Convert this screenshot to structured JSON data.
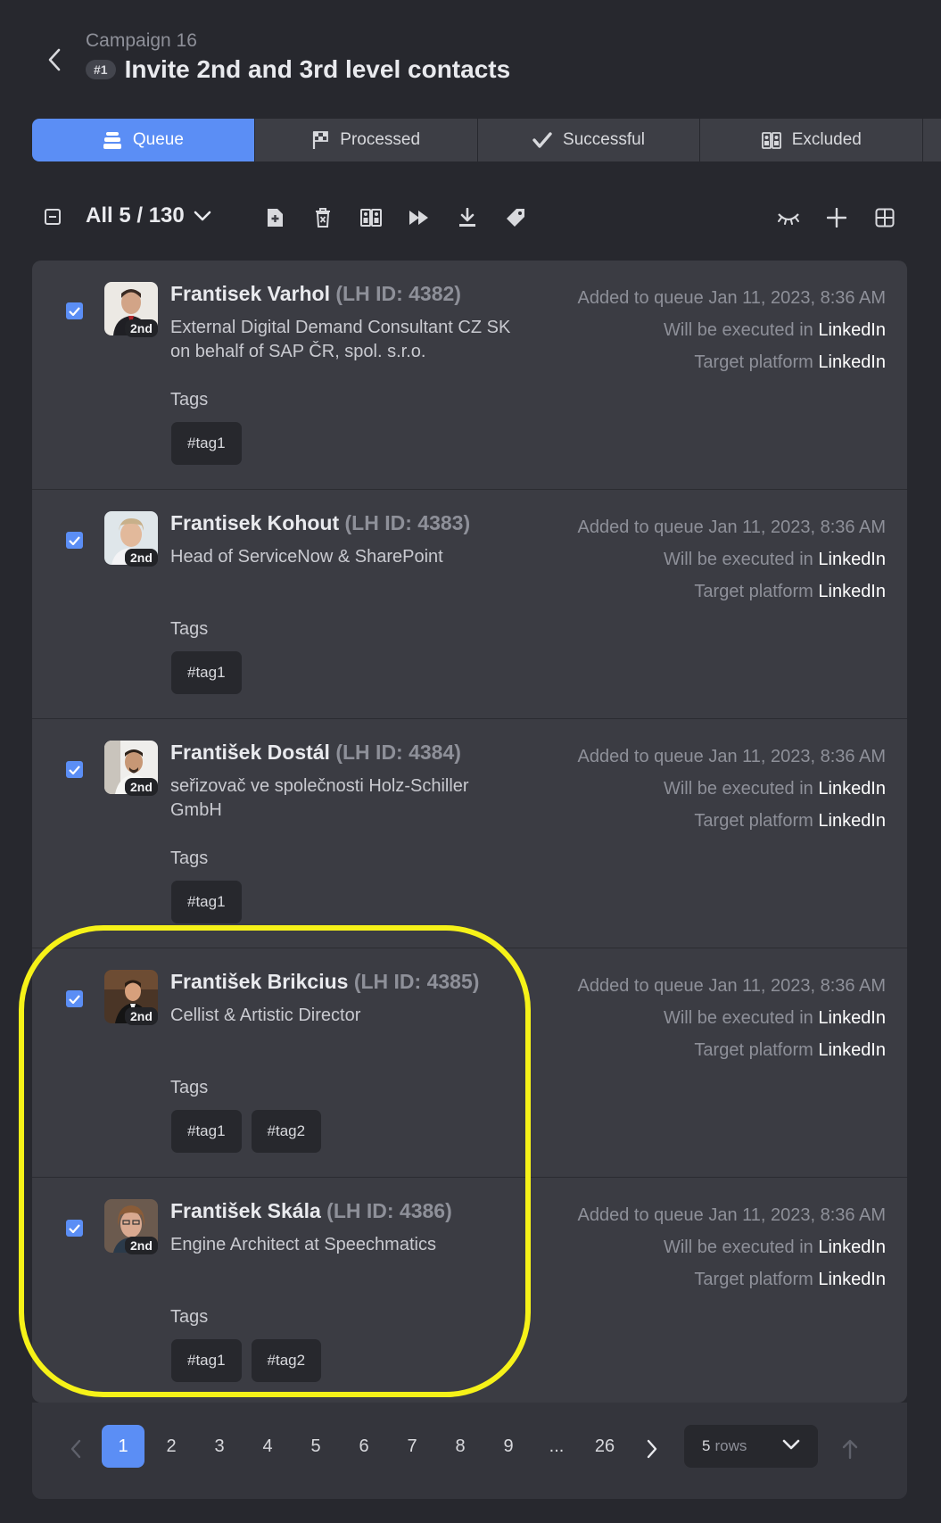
{
  "header": {
    "campaign": "Campaign 16",
    "badge": "#1",
    "title": "Invite 2nd and 3rd level contacts"
  },
  "tabs": [
    {
      "label": "Queue",
      "icon": "queue-stack-icon",
      "active": true
    },
    {
      "label": "Processed",
      "icon": "checkered-flag-icon",
      "active": false
    },
    {
      "label": "Successful",
      "icon": "checkmark-icon",
      "active": false
    },
    {
      "label": "Excluded",
      "icon": "excluded-people-icon",
      "active": false
    }
  ],
  "toolbar": {
    "selection": "All 5 / 130",
    "icons": [
      "add-to-list-icon",
      "delete-icon",
      "exclude-icon",
      "skip-forward-icon",
      "download-icon",
      "tag-icon",
      "hide-icon",
      "plus-icon",
      "grid-layout-icon"
    ]
  },
  "rows": [
    {
      "name": "Frantisek Varhol",
      "lhid": "(LH ID: 4382)",
      "degree": "2nd",
      "headline": "External Digital Demand Consultant CZ SK on behalf of SAP ČR, spol. s.r.o.",
      "tags_label": "Tags",
      "tags": [
        "#tag1"
      ],
      "added_label": "Added to queue",
      "added_date": "Jan 11, 2023, 8:36 AM",
      "exec_label": "Will be executed in",
      "exec_value": "LinkedIn",
      "platform_label": "Target platform",
      "platform_value": "LinkedIn",
      "checked": true
    },
    {
      "name": "Frantisek Kohout",
      "lhid": "(LH ID: 4383)",
      "degree": "2nd",
      "headline": "Head of ServiceNow & SharePoint",
      "tags_label": "Tags",
      "tags": [
        "#tag1"
      ],
      "added_label": "Added to queue",
      "added_date": "Jan 11, 2023, 8:36 AM",
      "exec_label": "Will be executed in",
      "exec_value": "LinkedIn",
      "platform_label": "Target platform",
      "platform_value": "LinkedIn",
      "checked": true
    },
    {
      "name": "František Dostál",
      "lhid": "(LH ID: 4384)",
      "degree": "2nd",
      "headline": "seřizovač ve společnosti Holz-Schiller GmbH",
      "tags_label": "Tags",
      "tags": [
        "#tag1"
      ],
      "added_label": "Added to queue",
      "added_date": "Jan 11, 2023, 8:36 AM",
      "exec_label": "Will be executed in",
      "exec_value": "LinkedIn",
      "platform_label": "Target platform",
      "platform_value": "LinkedIn",
      "checked": true
    },
    {
      "name": "František Brikcius",
      "lhid": "(LH ID: 4385)",
      "degree": "2nd",
      "headline": "Cellist & Artistic Director",
      "tags_label": "Tags",
      "tags": [
        "#tag1",
        "#tag2"
      ],
      "added_label": "Added to queue",
      "added_date": "Jan 11, 2023, 8:36 AM",
      "exec_label": "Will be executed in",
      "exec_value": "LinkedIn",
      "platform_label": "Target platform",
      "platform_value": "LinkedIn",
      "checked": true
    },
    {
      "name": "František Skála",
      "lhid": "(LH ID: 4386)",
      "degree": "2nd",
      "headline": "Engine Architect at Speechmatics",
      "tags_label": "Tags",
      "tags": [
        "#tag1",
        "#tag2"
      ],
      "added_label": "Added to queue",
      "added_date": "Jan 11, 2023, 8:36 AM",
      "exec_label": "Will be executed in",
      "exec_value": "LinkedIn",
      "platform_label": "Target platform",
      "platform_value": "LinkedIn",
      "checked": true
    }
  ],
  "pagination": {
    "pages": [
      "1",
      "2",
      "3",
      "4",
      "5",
      "6",
      "7",
      "8",
      "9",
      "...",
      "26"
    ],
    "current": "1",
    "rows_value": "5",
    "rows_unit": "rows"
  },
  "colors": {
    "accent": "#5b8ef5",
    "background": "#27282e",
    "card": "#3b3c43",
    "highlight": "#f6f218"
  }
}
